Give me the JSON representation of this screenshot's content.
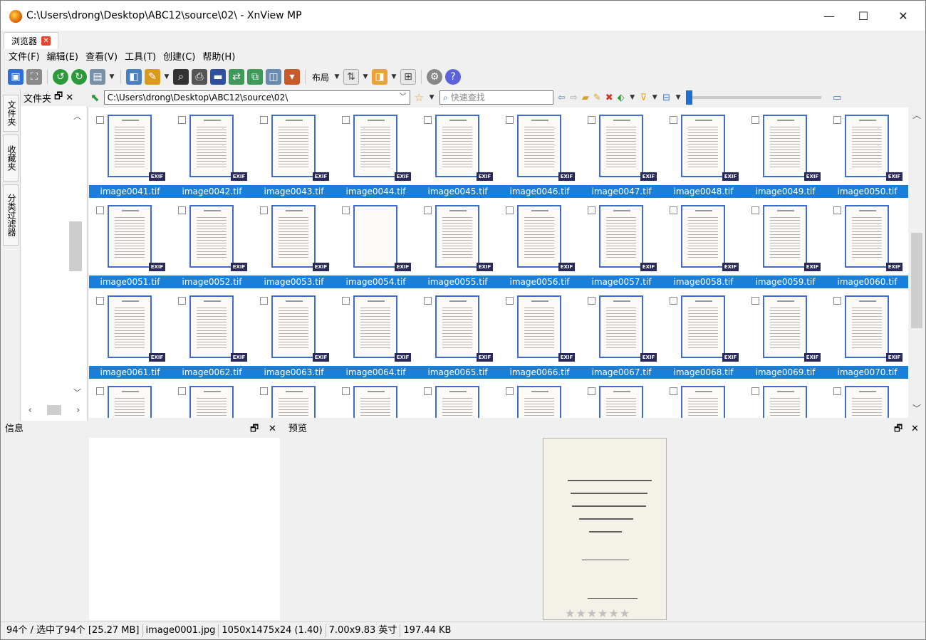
{
  "window": {
    "title": "C:\\Users\\drong\\Desktop\\ABC12\\source\\02\\ - XnView MP",
    "minimize": "—",
    "maximize": "☐",
    "close": "✕"
  },
  "tab": {
    "label": "浏览器",
    "close": "✕"
  },
  "menu": [
    "文件(F)",
    "编辑(E)",
    "查看(V)",
    "工具(T)",
    "创建(C)",
    "帮助(H)"
  ],
  "toolbar": {
    "layout_label": "布局",
    "icons": [
      "fullscreen-icon",
      "view-icon",
      "rotate-left-icon",
      "rotate-right-icon",
      "image-icon",
      "open-icon",
      "edit-icon",
      "find-icon",
      "print-icon",
      "slideshow-icon",
      "convert-icon",
      "batch-icon",
      "capture-icon",
      "present-icon",
      "settings-icon",
      "help-icon"
    ]
  },
  "sidetabs": [
    "文件夹",
    "收藏夹",
    "分类过滤器"
  ],
  "folder_panel": {
    "title": "文件夹",
    "pin": "🗗",
    "close": "✕"
  },
  "pathbar": {
    "path": "C:\\Users\\drong\\Desktop\\ABC12\\source\\02\\",
    "search_placeholder": "快速查找"
  },
  "thumbnails": {
    "rows": [
      [
        "image0041.tif",
        "image0042.tif",
        "image0043.tif",
        "image0044.tif",
        "image0045.tif",
        "image0046.tif",
        "image0047.tif",
        "image0048.tif",
        "image0049.tif",
        "image0050.tif"
      ],
      [
        "image0051.tif",
        "image0052.tif",
        "image0053.tif",
        "image0054.tif",
        "image0055.tif",
        "image0056.tif",
        "image0057.tif",
        "image0058.tif",
        "image0059.tif",
        "image0060.tif"
      ],
      [
        "image0061.tif",
        "image0062.tif",
        "image0063.tif",
        "image0064.tif",
        "image0065.tif",
        "image0066.tif",
        "image0067.tif",
        "image0068.tif",
        "image0069.tif",
        "image0070.tif"
      ]
    ],
    "exif_badge": "EXIF",
    "blank_file": "image0054.tif",
    "selected_color": "#1a7fd8"
  },
  "info_panel": {
    "title": "信息",
    "pin": "🗗",
    "close": "✕"
  },
  "preview_panel": {
    "title": "预览",
    "pin": "🗗",
    "close": "✕",
    "rating_stars": "★★★★★★"
  },
  "status": {
    "count": "94个 / 选中了94个 [25.27 MB]",
    "file": "image0001.jpg",
    "dimensions": "1050x1475x24 (1.40)",
    "print_size": "7.00x9.83 英寸",
    "file_size": "197.44 KB"
  }
}
